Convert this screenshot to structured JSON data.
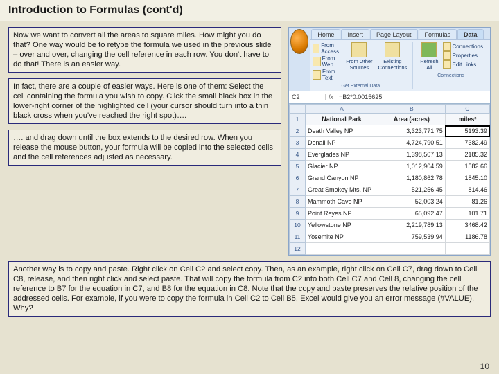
{
  "title": "Introduction to Formulas (cont'd)",
  "paragraphs": {
    "p1": "Now we want to convert all the areas to square miles.  How might you do that?  One way would be to retype the formula we used in the previous slide – over and over, changing the cell reference in each row.  You don't have to do that!  There is an easier way.",
    "p2": "In fact, there are a couple of easier ways.  Here is one of them: Select the cell containing the formula you wish to copy.  Click the small black box in the lower-right corner of the highlighted cell (your cursor should turn into a thin black cross when you've reached the right spot)….",
    "p3": "…. and drag down until the box extends to the desired row.  When you release the mouse button, your formula will be copied into the selected cells and the cell references adjusted as necessary.",
    "p4": "Another way is to copy and paste.  Right click on Cell C2 and select copy.  Then, as an example, right click on Cell C7, drag down to Cell C8, release, and then right click and select paste.  That will copy the formula from C2 into both Cell C7 and Cell 8, changing the cell reference to B7 for the equation in C7, and B8 for the equation in C8.  Note that the copy and paste preserves the relative position of the addressed cells.  For example, if you were to copy the formula in Cell C2 to Cell B5, Excel would give you an error message (#VALUE).  Why?"
  },
  "page_number": "10",
  "excel": {
    "tabs": [
      "Home",
      "Insert",
      "Page Layout",
      "Formulas",
      "Data"
    ],
    "active_tab": "Data",
    "ext_buttons": {
      "access": "From Access",
      "web": "From Web",
      "text": "From Text",
      "other": "From Other\nSources",
      "existing": "Existing\nConnections"
    },
    "ext_label": "Get External Data",
    "refresh": "Refresh\nAll",
    "conn_items": {
      "c": "Connections",
      "p": "Properties",
      "e": "Edit Links"
    },
    "conn_label": "Connections",
    "name_box": "C2",
    "fx": "fx",
    "formula": "=B2*0.0015625",
    "columns": [
      "",
      "A",
      "B",
      "C"
    ],
    "header_row": {
      "a": "National Park",
      "b": "Area (acres)",
      "c": "miles²"
    },
    "rows": [
      {
        "n": "1",
        "a": "",
        "b": "",
        "c": ""
      },
      {
        "n": "2",
        "a": "Death Valley NP",
        "b": "3,323,771.75",
        "c": "5193.39"
      },
      {
        "n": "3",
        "a": "Denali NP",
        "b": "4,724,790.51",
        "c": "7382.49"
      },
      {
        "n": "4",
        "a": "Everglades NP",
        "b": "1,398,507.13",
        "c": "2185.32"
      },
      {
        "n": "5",
        "a": "Glacier NP",
        "b": "1,012,904.59",
        "c": "1582.66"
      },
      {
        "n": "6",
        "a": "Grand Canyon NP",
        "b": "1,180,862.78",
        "c": "1845.10"
      },
      {
        "n": "7",
        "a": "Great Smokey Mts. NP",
        "b": "521,256.45",
        "c": "814.46"
      },
      {
        "n": "8",
        "a": "Mammoth Cave NP",
        "b": "52,003.24",
        "c": "81.26"
      },
      {
        "n": "9",
        "a": "Point Reyes NP",
        "b": "65,092.47",
        "c": "101.71"
      },
      {
        "n": "10",
        "a": "Yellowstone NP",
        "b": "2,219,789.13",
        "c": "3468.42"
      },
      {
        "n": "11",
        "a": "Yosemite NP",
        "b": "759,539.94",
        "c": "1186.78"
      },
      {
        "n": "12",
        "a": "",
        "b": "",
        "c": ""
      }
    ]
  }
}
